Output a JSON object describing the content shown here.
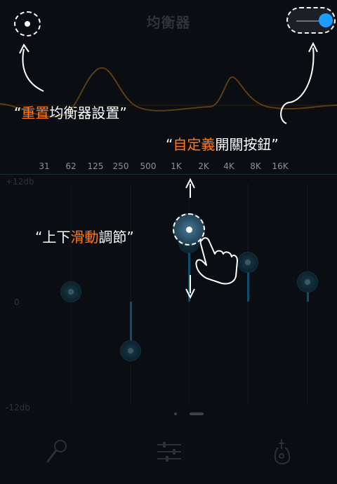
{
  "screen": {
    "title": "均衡器",
    "frequencies": [
      "31",
      "62",
      "125",
      "250",
      "500",
      "1K",
      "2K",
      "4K",
      "8K",
      "16K"
    ],
    "db_max_label": "+12db",
    "db_zero_label": "0",
    "db_min_label": "-12db",
    "slider_levels_db": [
      1,
      -5,
      6,
      6,
      4,
      2
    ],
    "bottom_nav": [
      "microphone-icon",
      "equalizer-icon",
      "guitar-icon"
    ],
    "pager": {
      "pages": 2,
      "current": 2
    }
  },
  "guide": {
    "reset_hint": {
      "open_quote": "“",
      "accent": "重置",
      "rest": "均衡器設置",
      "close_quote": "”"
    },
    "custom_hint": {
      "open_quote": "“",
      "accent": "自定義",
      "rest": "開關按鈕",
      "close_quote": "”"
    },
    "slide_hint": {
      "open_quote": "“",
      "prefix": "上下",
      "accent": "滑動",
      "rest": "調節",
      "close_quote": "”"
    }
  },
  "colors": {
    "accent_orange": "#ff7a1a",
    "toggle_blue": "#1e9bff",
    "background": "#0a0e12",
    "curve": "#5a3d16"
  },
  "toggle": {
    "on": true
  }
}
